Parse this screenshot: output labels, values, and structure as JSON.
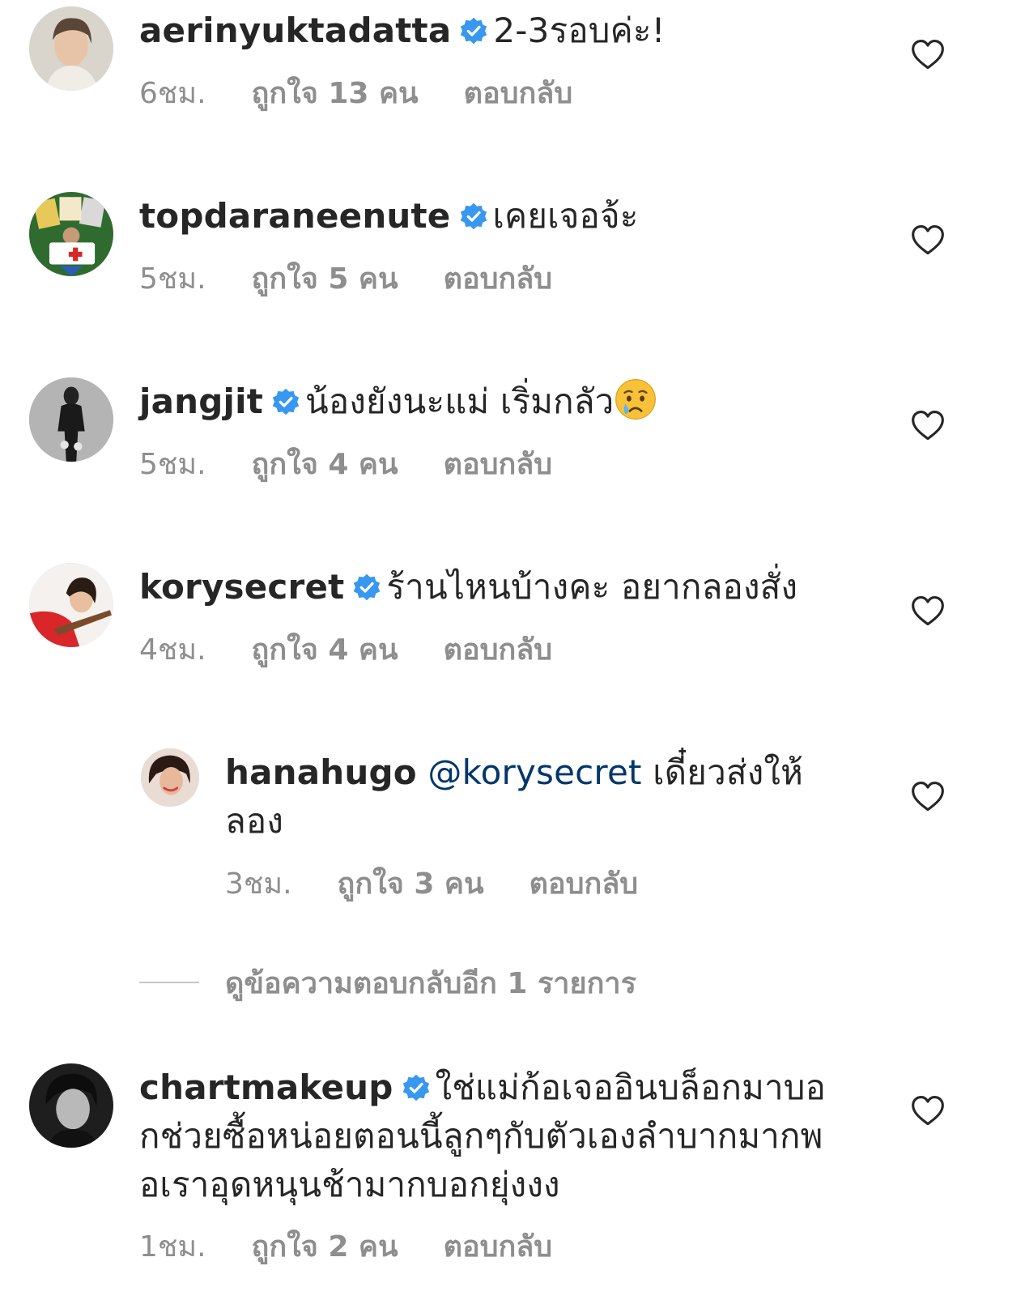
{
  "icons": {
    "verified": "verified-badge-icon",
    "heart": "heart-outline-icon",
    "emoji_crying": "crying-face-emoji"
  },
  "colors": {
    "verified": "#3897f0",
    "mention": "#00376b",
    "meta": "#8e8e8e",
    "text": "#262626"
  },
  "comments": [
    {
      "username": "aerinyuktadatta",
      "text": "2-3รอบค่ะ!",
      "time": "6ชม.",
      "likes": "ถูกใจ 13 คน",
      "reply": "ตอบกลับ"
    },
    {
      "username": "topdaraneenute",
      "text": "เคยเจอจ้ะ",
      "time": "5ชม.",
      "likes": "ถูกใจ 5 คน",
      "reply": "ตอบกลับ"
    },
    {
      "username": "jangjit",
      "text": "น้องยังนะแม่ เริ่มกลัว",
      "time": "5ชม.",
      "likes": "ถูกใจ 4 คน",
      "reply": "ตอบกลับ"
    },
    {
      "username": "korysecret",
      "text": "ร้านไหนบ้างคะ อยากลองสั่ง",
      "time": "4ชม.",
      "likes": "ถูกใจ 4 คน",
      "reply": "ตอบกลับ"
    },
    {
      "username": "chartmakeup",
      "text": "ใช่แม่ก้อเจออินบล็อกมาบอกช่วยซื้อหน่อยตอนนี้ลูกๆกับตัวเองลำบากมากพอเราอุดหนุนช้ามากบอกยุ่งงง",
      "time": "1ชม.",
      "likes": "ถูกใจ 2 คน",
      "reply": "ตอบกลับ"
    }
  ],
  "reply_comment": {
    "username": "hanahugo",
    "mention": "@korysecret",
    "text": "เดี๋ยวส่งให้ลอง",
    "time": "3ชม.",
    "likes": "ถูกใจ 3 คน",
    "reply": "ตอบกลับ"
  },
  "view_more_replies": "ดูข้อความตอบกลับอีก 1 รายการ"
}
